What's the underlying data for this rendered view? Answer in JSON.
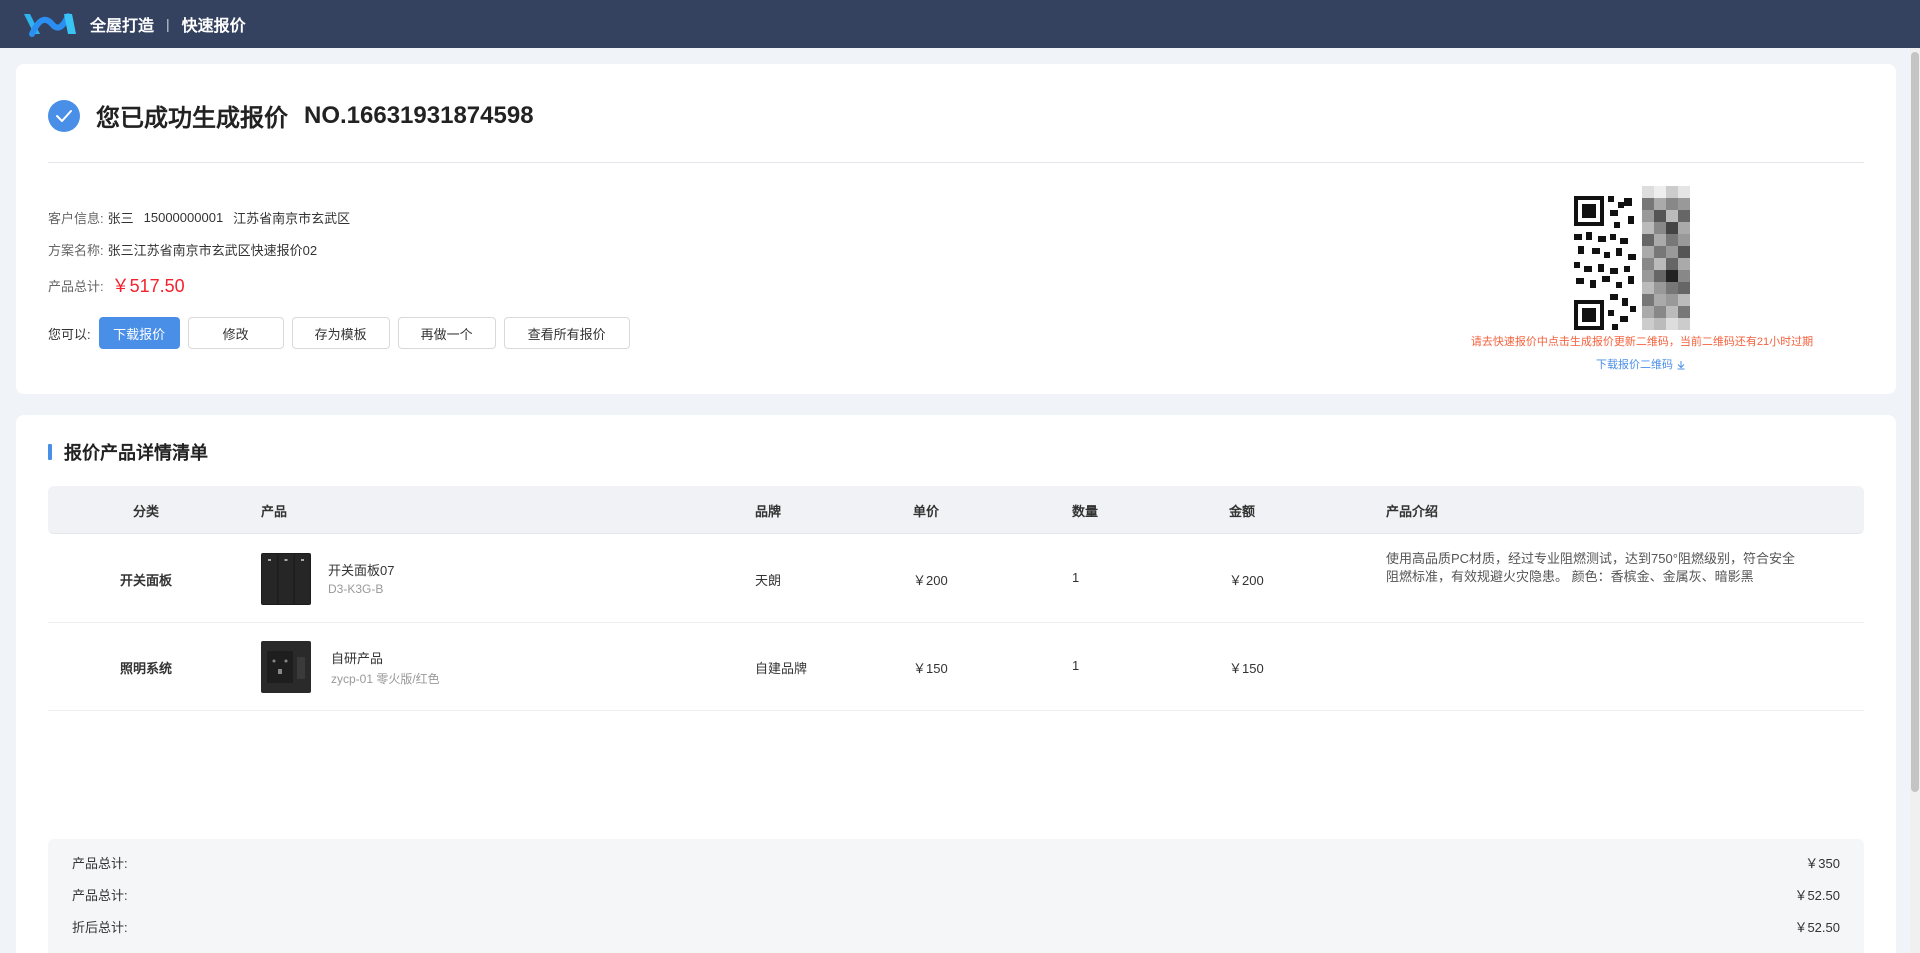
{
  "header": {
    "app_title": "全屋打造",
    "separator": "|",
    "page_title": "快速报价"
  },
  "success": {
    "title": "您已成功生成报价",
    "order_no": "NO.16631931874598"
  },
  "info": {
    "customer_label": "客户信息:",
    "customer_name": "张三",
    "customer_phone": "15000000001",
    "customer_address": "江苏省南京市玄武区",
    "plan_label": "方案名称:",
    "plan_name": "张三江苏省南京市玄武区快速报价02",
    "total_label": "产品总计:",
    "total_value": "￥517.50"
  },
  "actions": {
    "label": "您可以:",
    "download": "下载报价",
    "edit": "修改",
    "save_template": "存为模板",
    "redo": "再做一个",
    "view_all": "查看所有报价"
  },
  "qr": {
    "notice": "请去快速报价中点击生成报价更新二维码，当前二维码还有21小时过期",
    "download_label": "下载报价二维码"
  },
  "list": {
    "title": "报价产品详情清单",
    "columns": [
      "分类",
      "产品",
      "品牌",
      "单价",
      "数量",
      "金额",
      "产品介绍"
    ],
    "rows": [
      {
        "category": "开关面板",
        "product_name": "开关面板07",
        "product_code": "D3-K3G-B",
        "brand": "天朗",
        "unit_price": "￥200",
        "quantity": "1",
        "amount": "￥200",
        "intro": "使用高品质PC材质，经过专业阻燃测试，达到750°阻燃级别，符合安全阻燃标准，有效规避火灾隐患。 颜色：香槟金、金属灰、暗影黑"
      },
      {
        "category": "照明系统",
        "product_name": "自研产品",
        "product_code": "zycp-01 零火版/红色",
        "brand": "自建品牌",
        "unit_price": "￥150",
        "quantity": "1",
        "amount": "￥150",
        "intro": ""
      }
    ]
  },
  "summary": [
    {
      "label": "产品总计:",
      "value": "￥350"
    },
    {
      "label": "产品总计:",
      "value": "￥52.50"
    },
    {
      "label": "折后总计:",
      "value": "￥52.50"
    }
  ],
  "colors": {
    "topbar": "#344260",
    "accent": "#4a8fe7",
    "price": "#f5222d",
    "notice": "#f5623d"
  }
}
